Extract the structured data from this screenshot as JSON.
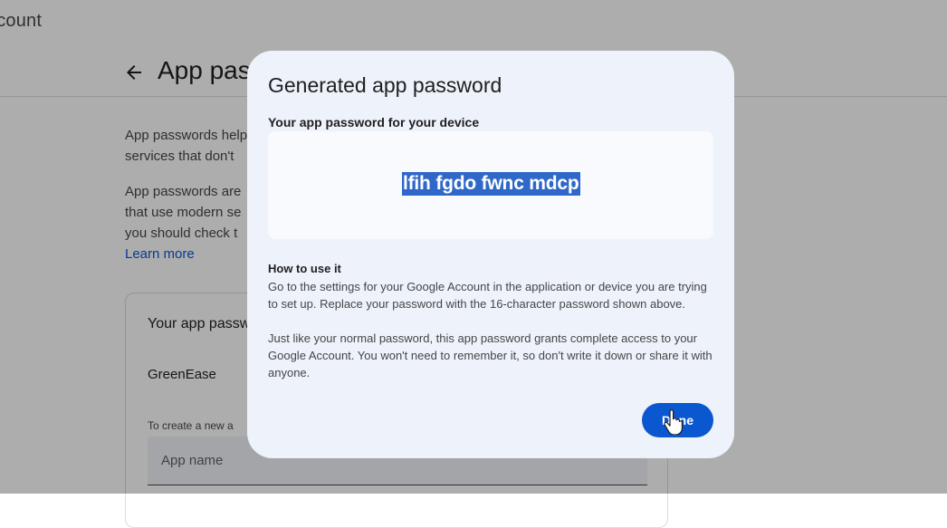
{
  "page": {
    "brand": "ccount",
    "title": "App pas",
    "intro_1": "App passwords hel​p\nservices that don't",
    "intro_2": "App passwords are\nthat use modern se\nyou should check t",
    "learn_more": "Learn more",
    "card": {
      "title": "Your app passw",
      "item": "GreenEase",
      "create_hint": "To create a new a",
      "app_name_placeholder": "App name"
    }
  },
  "dialog": {
    "title": "Generated app password",
    "subtitle": "Your app password for your device",
    "password": "lfih fgdo fwnc mdcp",
    "howto_title": "How to use it",
    "howto_p1": "Go to the settings for your Google Account in the application or device you are trying to set up. Replace your password with the 16-character password shown above.",
    "howto_p2": "Just like your normal password, this app password grants complete access to your Google Account. You won't need to remember it, so don't write it down or share it with anyone.",
    "done_label": "Done"
  },
  "icons": {
    "back": "arrow-back-icon",
    "cursor": "hand-pointer-icon"
  },
  "colors": {
    "primary": "#0b57d0",
    "dialog_bg": "#eef2fb",
    "selection": "#2f68c9",
    "scrim": "rgba(0,0,0,0.32)"
  }
}
